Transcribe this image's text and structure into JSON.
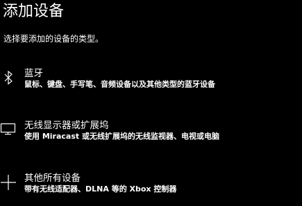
{
  "dialog": {
    "title": "添加设备",
    "subtitle": "选择要添加的设备的类型。"
  },
  "options": [
    {
      "icon": "bluetooth-icon",
      "label": "蓝牙",
      "description": "鼠标、键盘、手写笔、音频设备以及其他类型的蓝牙设备"
    },
    {
      "icon": "monitor-icon",
      "label": "无线显示器或扩展坞",
      "description": "使用 Miracast 或无线扩展坞的无线监视器、电视或电脑"
    },
    {
      "icon": "plus-icon",
      "label": "其他所有设备",
      "description": "带有无线适配器、DLNA 等的 Xbox 控制器"
    }
  ],
  "colors": {
    "background": "#000000",
    "text": "#ffffff"
  }
}
